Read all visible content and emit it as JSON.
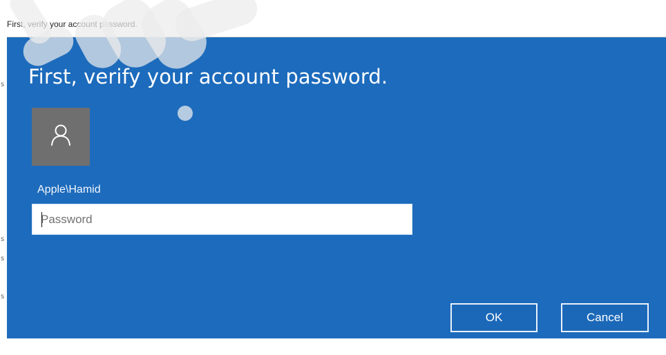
{
  "dialog": {
    "title": "First, verify your account password.",
    "heading": "First, verify your account password.",
    "account_name": "Apple\\Hamid",
    "avatar_icon": "person-icon",
    "password": {
      "placeholder": "Password",
      "value": ""
    },
    "buttons": {
      "ok_label": "OK",
      "cancel_label": "Cancel"
    },
    "colors": {
      "background": "#1d6bbc",
      "avatar": "#6f6f6f",
      "button_border": "#eaf2fb"
    }
  },
  "background": {
    "left_edge_marks": [
      "s",
      "s",
      "s",
      "s"
    ]
  }
}
